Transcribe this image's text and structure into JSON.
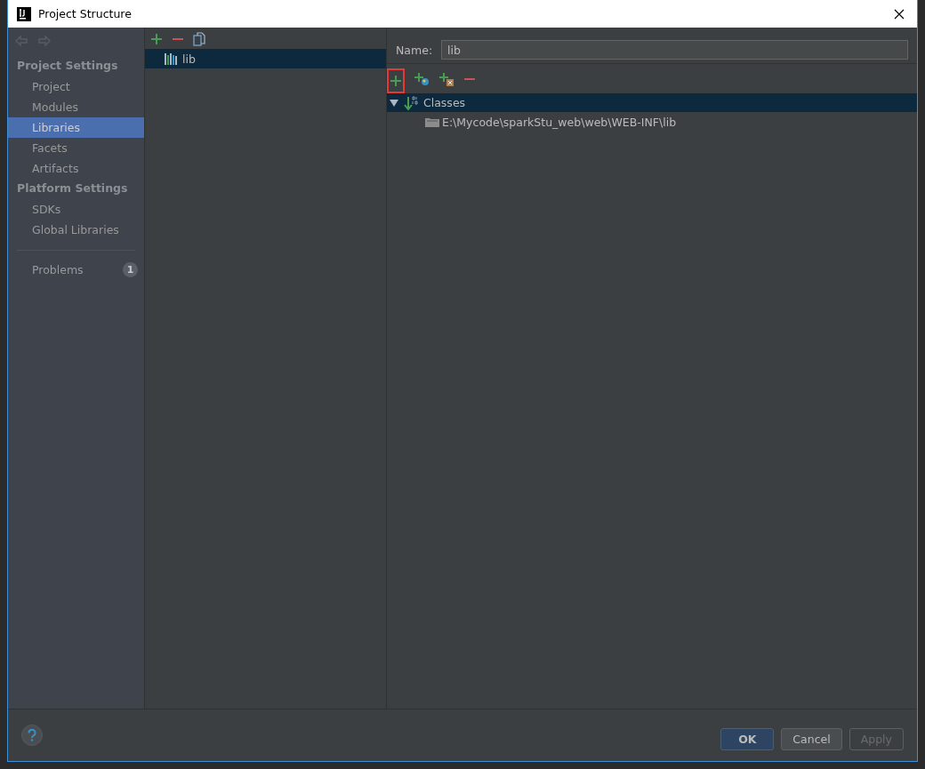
{
  "window": {
    "title": "Project Structure"
  },
  "sidebar": {
    "sections": [
      {
        "heading": "Project Settings",
        "items": [
          {
            "label": "Project",
            "selected": false
          },
          {
            "label": "Modules",
            "selected": false
          },
          {
            "label": "Libraries",
            "selected": true
          },
          {
            "label": "Facets",
            "selected": false
          },
          {
            "label": "Artifacts",
            "selected": false
          }
        ]
      },
      {
        "heading": "Platform Settings",
        "items": [
          {
            "label": "SDKs",
            "selected": false
          },
          {
            "label": "Global Libraries",
            "selected": false
          }
        ]
      }
    ],
    "problems": {
      "label": "Problems",
      "count": "1"
    }
  },
  "libraries": {
    "items": [
      {
        "label": "lib",
        "selected": true
      }
    ]
  },
  "detail": {
    "name_field": {
      "label": "Name:",
      "value": "lib"
    },
    "tree": [
      {
        "label": "Classes",
        "expanded": true,
        "selected": true,
        "children": [
          {
            "label": "E:\\Mycode\\sparkStu_web\\web\\WEB-INF\\lib"
          }
        ]
      }
    ]
  },
  "buttons": [
    {
      "label": "OK",
      "kind": "primary",
      "disabled": false
    },
    {
      "label": "Cancel",
      "kind": "normal",
      "disabled": false
    },
    {
      "label": "Apply",
      "kind": "normal",
      "disabled": true
    }
  ]
}
